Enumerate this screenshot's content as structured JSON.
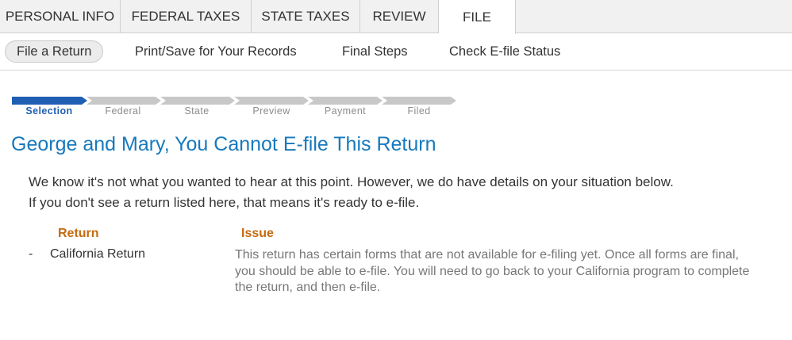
{
  "topnav": {
    "tabs": [
      {
        "label": "PERSONAL INFO",
        "active": false
      },
      {
        "label": "FEDERAL TAXES",
        "active": false
      },
      {
        "label": "STATE TAXES",
        "active": false
      },
      {
        "label": "REVIEW",
        "active": false
      },
      {
        "label": "FILE",
        "active": true
      }
    ]
  },
  "subnav": {
    "items": [
      {
        "label": "File a Return",
        "active": true
      },
      {
        "label": "Print/Save for Your Records",
        "active": false
      },
      {
        "label": "Final Steps",
        "active": false
      },
      {
        "label": "Check E-file Status",
        "active": false
      }
    ]
  },
  "progress": {
    "steps": [
      "Selection",
      "Federal",
      "State",
      "Preview",
      "Payment",
      "Filed"
    ],
    "current_step": 1,
    "active_color": "#1f5fb3",
    "inactive_color": "#c8c8c8"
  },
  "main": {
    "title": "George and Mary, You Cannot E-file This Return",
    "message_line1": "We know it's not what you wanted to hear at this point. However, we do have details on your situation below.",
    "message_line2": "If you don't see a return listed here, that means it's ready to e-file.",
    "table": {
      "headers": {
        "return": "Return",
        "issue": "Issue"
      },
      "rows": [
        {
          "bullet": "-",
          "return": "California Return",
          "issue": "This return has certain forms that are not available for e-filing yet. Once all forms are final, you should be able to e-file. You will need to go back to your California program to complete the return, and then e-file."
        }
      ]
    }
  },
  "colors": {
    "title": "#1779bd",
    "column_header": "#c46b10",
    "issue_text": "#777777"
  }
}
